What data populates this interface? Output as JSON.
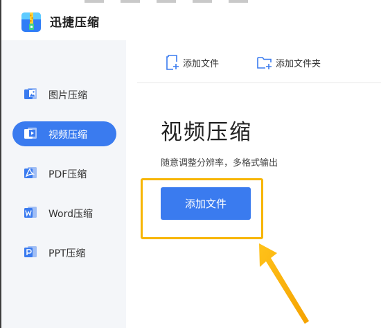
{
  "app": {
    "title": "迅捷压缩",
    "icon": "zip-archive-icon"
  },
  "sidebar": {
    "items": [
      {
        "label": "图片压缩",
        "icon": "image-icon",
        "active": false
      },
      {
        "label": "视频压缩",
        "icon": "video-icon",
        "active": true
      },
      {
        "label": "PDF压缩",
        "icon": "pdf-icon",
        "active": false
      },
      {
        "label": "Word压缩",
        "icon": "word-icon",
        "active": false
      },
      {
        "label": "PPT压缩",
        "icon": "ppt-icon",
        "active": false
      }
    ]
  },
  "toolbar": {
    "add_file_label": "添加文件",
    "add_file_icon": "add-file-icon",
    "add_folder_label": "添加文件夹",
    "add_folder_icon": "add-folder-icon"
  },
  "main": {
    "title": "视频压缩",
    "subtitle": "随意调整分辨率，多格式输出",
    "add_file_button": "添加文件"
  },
  "colors": {
    "accent": "#3a7bef",
    "highlight": "#f7b500",
    "sidebar_bg": "#f4f6f9"
  }
}
